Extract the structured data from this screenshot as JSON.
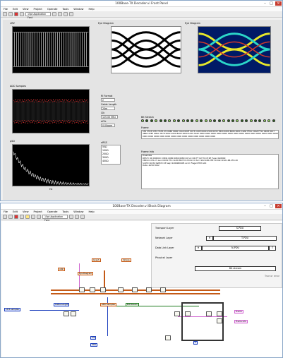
{
  "front_panel": {
    "title": "100Base-TX Decoder.vi Front Panel",
    "menu": [
      "File",
      "Edit",
      "View",
      "Project",
      "Operate",
      "Tools",
      "Window",
      "Help"
    ],
    "font_selector": "15pt Application Font",
    "graphs": {
      "nrz_label": "nRZ",
      "eye_label": "Eye Diagram",
      "eye2_label": "Eye Diagram",
      "adc_label": "ADC Samples",
      "psd_label": "pSD",
      "axis_x": "Time",
      "axis_x_psd": "Hz"
    },
    "controls": {
      "filter_label": "RI Format",
      "filter_value": "2",
      "cable_label": "Cable Length",
      "cable_value": "20m",
      "clk_label": "Clk",
      "clk_value": "125.00 MHz",
      "adc_label": "dClk",
      "adc_value": "0.00ppm"
    },
    "bitstream_label": "Bit Stream",
    "frame_label": "Frame",
    "frame_text": "555 5555 5555 5555 D5 0080 0000 C0A0 000F 0075 C00E 0000 4500 0030 7B24 4000 8006 000C C0A8 FF0A C0A8 FF14 0408 0017 4B84 1E8F 000A 3D78 5002 2000 8A63 0000 4A59 3042 0000 0000 0000 0000 0000 0000 0000 0000 0000 0000 0000 0000 0000 0000 0000 0000 0000 0000 0000 0000 0000 0000 0000 0000 0000 0000 0000",
    "frame_info_label": "Frame Info",
    "frame_info": [
      "Preamble",
      "DEST= 00  D0D00= 05D4 0080 0080 0080 C0  Src=00 FF 02 F0 CE 0E  Type=0x0800",
      "VERS=4  IHL=5  Len=0030  TTL=128  PROT=6  HChk=0  Src=192.168.255.10  Dst=192.168.255.20",
      "SrcPrt=1032  DstPrt=23  Seq=1266900495  Ack=  Flags=PSH ACK",
      "Data: 4A59 3042"
    ],
    "side_list_label": "nRSS",
    "side_list": [
      "50Ω",
      "100Ω",
      "200Ω",
      "300Ω",
      "400Ω"
    ]
  },
  "block_diagram": {
    "title": "100Base-TX Decoder.vi Block Diagram",
    "menu": [
      "File",
      "Edit",
      "View",
      "Project",
      "Operate",
      "Tools",
      "Window",
      "Help"
    ],
    "font_selector": "15pt Application Font",
    "layers": {
      "transport": "Transport Layer",
      "network": "Network Layer",
      "datalink": "Data Link Layer",
      "physical": "Physical Layer",
      "spdu": "S-PDU",
      "tpdu": "T-PDU",
      "npdu": "N-PDU",
      "bitstream": "Bit stream",
      "h": "H",
      "t": "T",
      "true_label": "True or error"
    },
    "nodes": {
      "nrz": "nRZ",
      "eye": "Eye Diagram",
      "graph": "Graph",
      "simple": "Simple",
      "adc": "ADC Samples",
      "bitstream": "Bit Stream",
      "cable": "Cable Length",
      "frame": "Frame",
      "frame_info": "Frame Info",
      "clk": "Clk",
      "dclk": "dClk",
      "vi_samples": "10.5 samples",
      "const1": "1"
    }
  }
}
